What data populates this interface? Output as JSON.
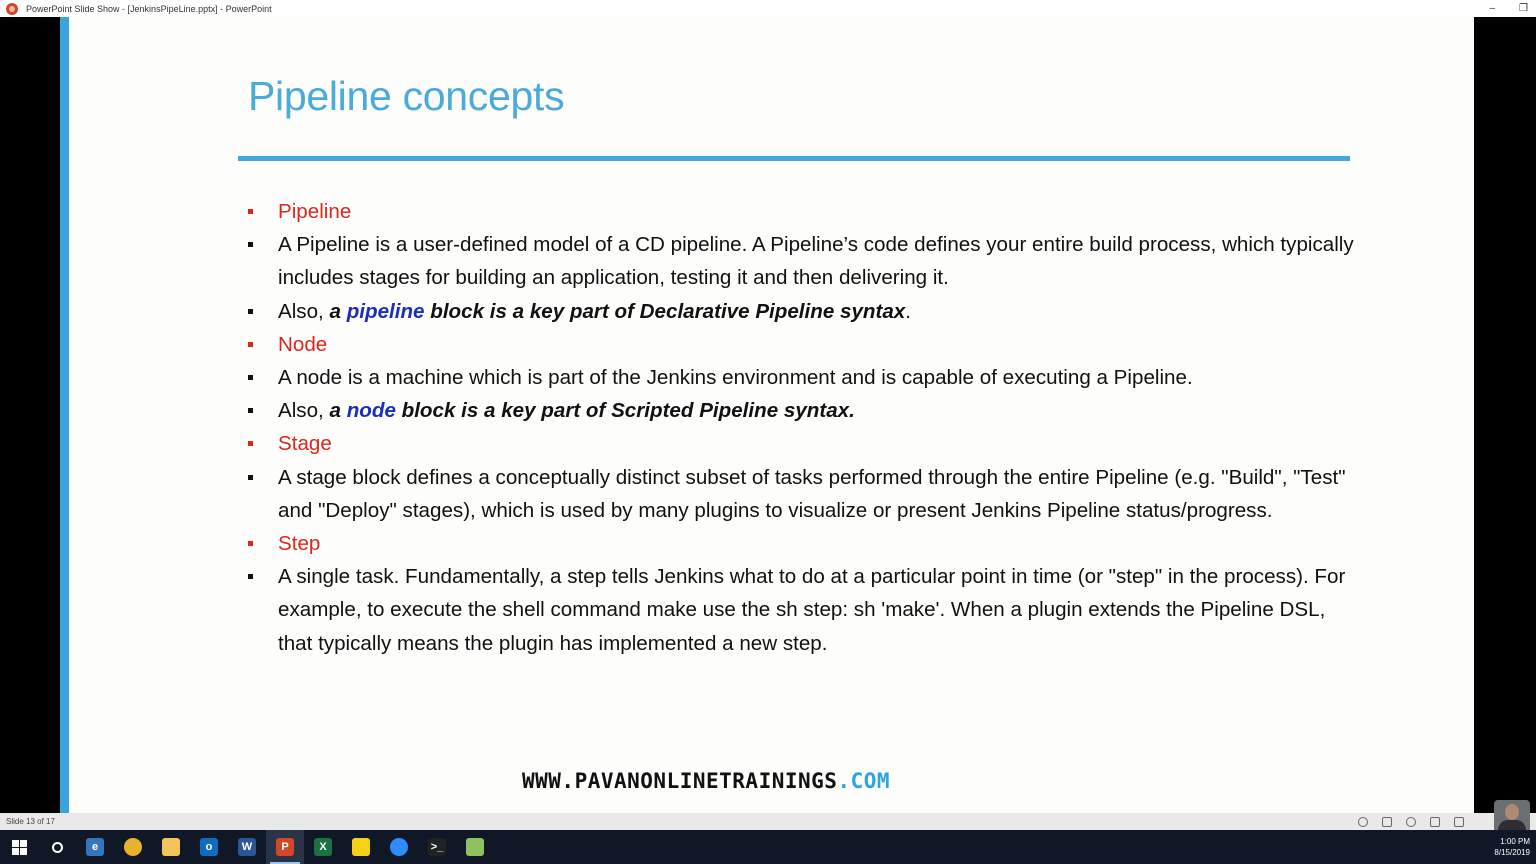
{
  "window": {
    "title": "PowerPoint Slide Show - [JenkinsPipeLine.pptx] - PowerPoint",
    "minimize": "–",
    "restore": "❐",
    "close": "✕"
  },
  "slide": {
    "title": "Pipeline concepts",
    "bullets": [
      {
        "type": "head",
        "text": "Pipeline"
      },
      {
        "type": "body",
        "text": "A Pipeline is a user-defined model of a CD pipeline. A Pipeline’s code defines your entire build process, which typically includes stages for building an application, testing it and then delivering it."
      },
      {
        "type": "mixed",
        "prefix": "Also, ",
        "em1": "a ",
        "keyword": "pipeline",
        "em2": " block is a key part of Declarative Pipeline syntax",
        "suffix": "."
      },
      {
        "type": "head",
        "text": "Node"
      },
      {
        "type": "body",
        "text": "A node is a machine which is part of the Jenkins environment and is capable of executing a Pipeline."
      },
      {
        "type": "mixed",
        "prefix": "Also, ",
        "em1": "a ",
        "keyword": "node",
        "em2": " block is a key part of Scripted Pipeline syntax.",
        "suffix": ""
      },
      {
        "type": "head",
        "text": "Stage"
      },
      {
        "type": "body",
        "text": "A stage block defines a conceptually distinct subset of tasks performed through the entire Pipeline (e.g. \"Build\", \"Test\" and \"Deploy\" stages), which is used by many plugins to visualize or present Jenkins Pipeline status/progress."
      },
      {
        "type": "head",
        "text": "Step"
      },
      {
        "type": "body",
        "text": "A single task. Fundamentally, a step tells Jenkins what to do at a particular point in time (or \"step\" in the process). For example, to execute the shell command make use the sh step: sh 'make'. When a plugin extends the Pipeline DSL, that typically means the plugin has implemented a new step."
      }
    ],
    "footer_main": "WWW.PAVANONLINETRAININGS",
    "footer_suffix": ".COM"
  },
  "status": {
    "slide_info": "Slide 13 of 17"
  },
  "taskbar": {
    "apps": [
      {
        "name": "start",
        "icon": "windows-icon",
        "color": "#ffffff"
      },
      {
        "name": "cortana",
        "icon": "cortana-icon",
        "color": "#ffffff"
      },
      {
        "name": "edge",
        "icon": "edge-icon",
        "label": "e",
        "color": "#3277bc"
      },
      {
        "name": "chrome",
        "icon": "chrome-icon",
        "label": "",
        "color": "#e8b32a"
      },
      {
        "name": "explorer",
        "icon": "folder-icon",
        "label": "",
        "color": "#f2c55c"
      },
      {
        "name": "outlook",
        "icon": "outlook-icon",
        "label": "o",
        "color": "#0f6cc0"
      },
      {
        "name": "word",
        "icon": "word-icon",
        "label": "W",
        "color": "#2b5796"
      },
      {
        "name": "powerpoint",
        "icon": "powerpoint-icon",
        "label": "P",
        "color": "#d24726",
        "active": true
      },
      {
        "name": "excel",
        "icon": "excel-icon",
        "label": "X",
        "color": "#1e7145"
      },
      {
        "name": "sticky",
        "icon": "sticky-notes-icon",
        "label": "",
        "color": "#f5d11b"
      },
      {
        "name": "zoom",
        "icon": "zoom-icon",
        "label": "",
        "color": "#2d8cff"
      },
      {
        "name": "terminal",
        "icon": "terminal-icon",
        "label": ">_",
        "color": "#222222"
      },
      {
        "name": "notepad",
        "icon": "notepad-icon",
        "label": "",
        "color": "#8fc25e"
      }
    ],
    "time": "1:00 PM",
    "date": "8/15/2019"
  }
}
